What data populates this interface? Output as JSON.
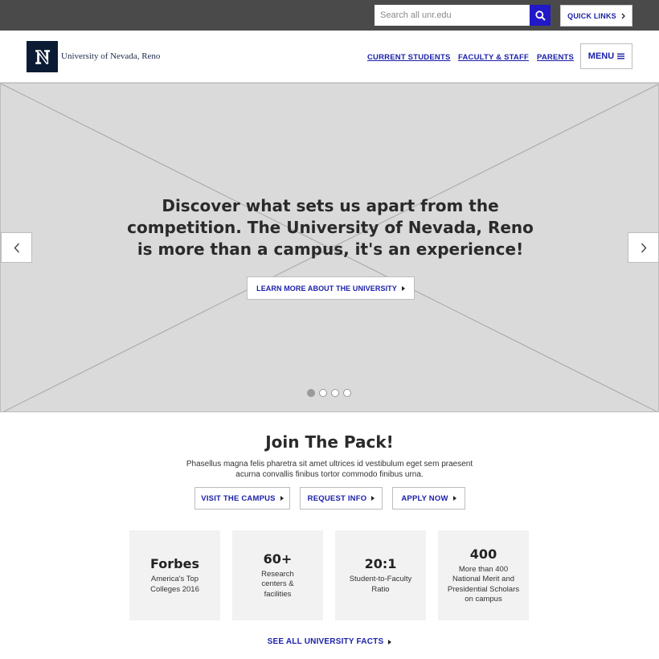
{
  "topbar": {
    "search_placeholder": "Search all unr.edu",
    "quick_links_label": "QUICK LINKS"
  },
  "header": {
    "logo_letter": "N",
    "logo_text": "University of Nevada, Reno",
    "nav": [
      {
        "label": "CURRENT STUDENTS"
      },
      {
        "label": "FACULTY & STAFF"
      },
      {
        "label": "PARENTS"
      }
    ],
    "menu_label": "MENU"
  },
  "hero": {
    "heading": "Discover what sets us apart from the competition. The University of Nevada, Reno is more than a campus, it's an experience!",
    "cta_label": "LEARN MORE ABOUT THE UNIVERSITY",
    "slide_count": 4,
    "active_slide": 1
  },
  "join": {
    "title": "Join The Pack!",
    "description": "Phasellus magna felis pharetra sit amet ultrices id vestibulum eget sem praesent acurna convallis finibus tortor commodo finibus urna.",
    "buttons": [
      {
        "label": "VISIT THE CAMPUS"
      },
      {
        "label": "REQUEST INFO"
      },
      {
        "label": "APPLY NOW"
      }
    ]
  },
  "facts": [
    {
      "big": "Forbes",
      "small": "America's Top Colleges 2016"
    },
    {
      "big": "60+",
      "small": "Research centers & facilities"
    },
    {
      "big": "20:1",
      "small": "Student-to-Faculty Ratio"
    },
    {
      "big": "400",
      "small": "More than 400 National Merit and Presidential Scholars on campus"
    }
  ],
  "see_all_label": "SEE ALL UNIVERSITY FACTS",
  "colors": {
    "accent": "#1a1fa8",
    "search_button": "#2118c8",
    "topbar": "#4a4a4a",
    "logo_bg": "#0b1b33"
  }
}
